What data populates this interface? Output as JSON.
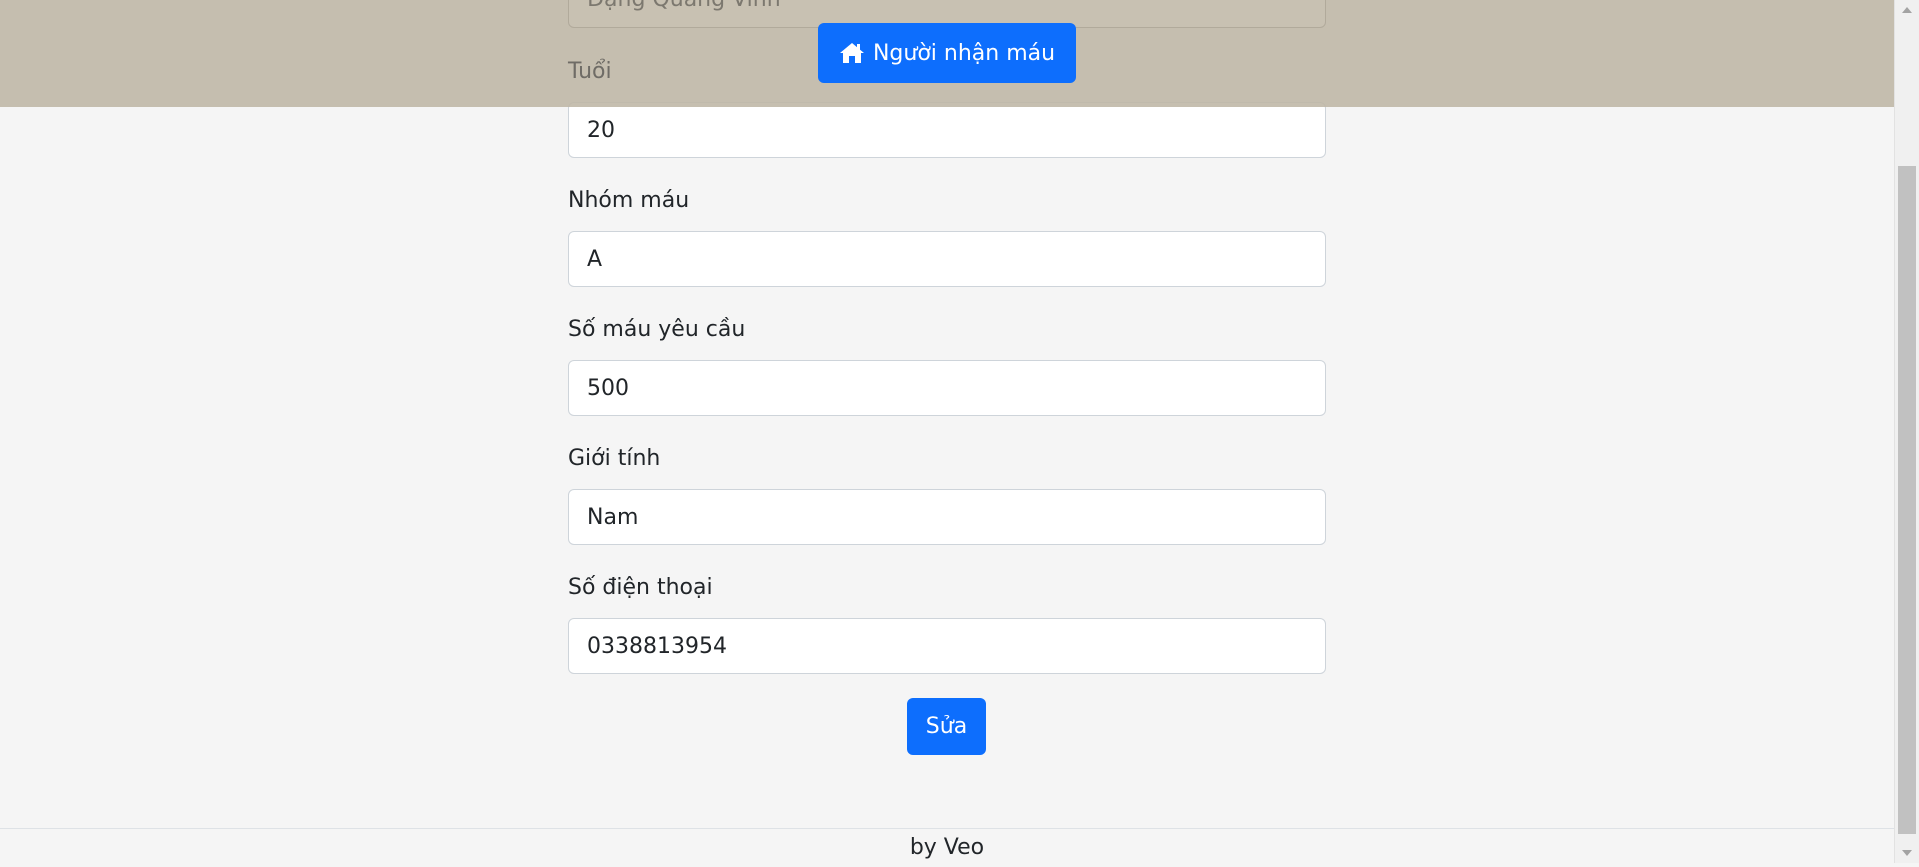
{
  "header": {
    "home_button_label": "Người nhận máu",
    "home_icon": "home-icon",
    "partial_name_value": "Đặng Quang Vinh",
    "age_label": "Tuổi",
    "background_color": "#c4bcae",
    "accent_color": "#0d6efd"
  },
  "form": {
    "age": {
      "label": "Tuổi",
      "value": "20"
    },
    "blood_group": {
      "label": "Nhóm máu",
      "value": "A"
    },
    "requested_amount": {
      "label": "Số máu yêu cầu",
      "value": "500"
    },
    "gender": {
      "label": "Giới tính",
      "value": "Nam"
    },
    "phone": {
      "label": "Số điện thoại",
      "value": "0338813954"
    },
    "submit_label": "Sửa"
  },
  "footer": {
    "text": "by Veo"
  }
}
